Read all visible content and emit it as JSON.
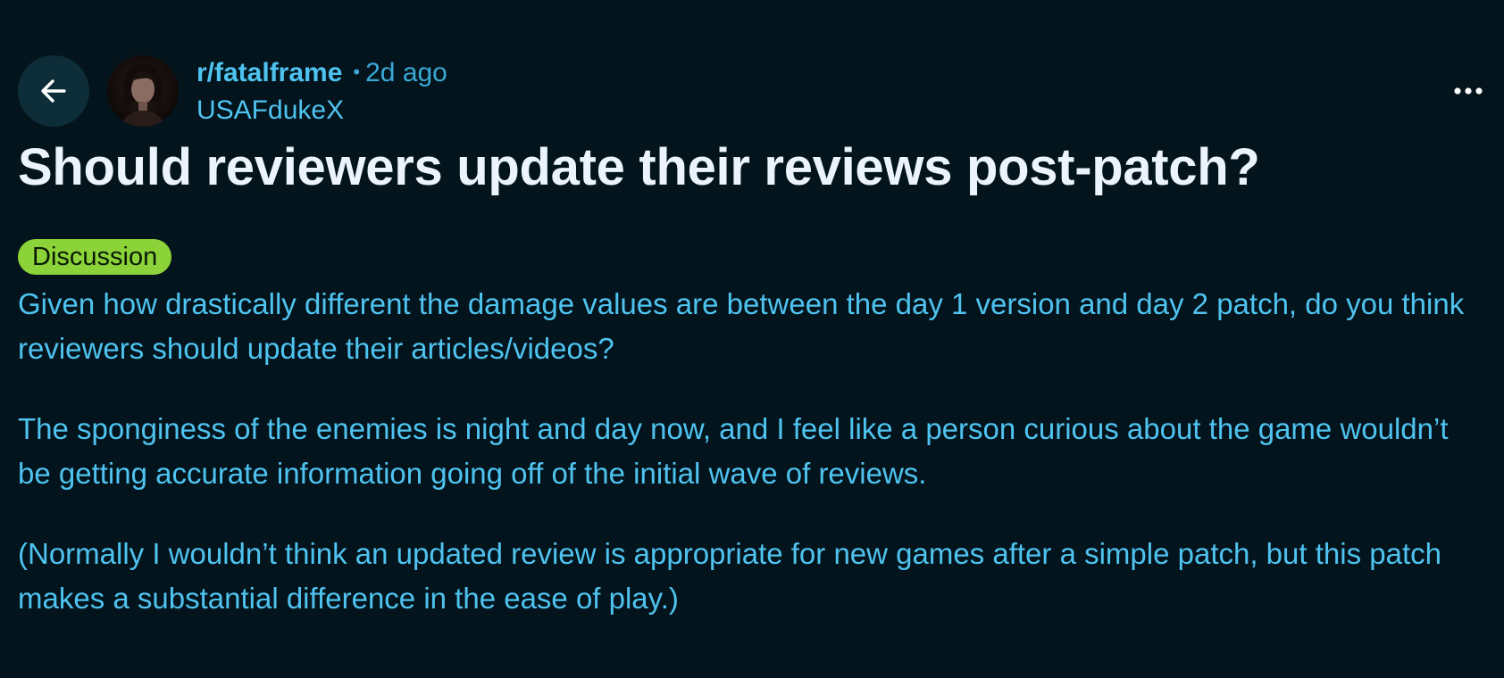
{
  "post": {
    "subreddit": "r/fatalframe",
    "time_ago": "2d ago",
    "author": "USAFdukeX",
    "title": "Should reviewers update their reviews post-patch?",
    "flair": "Discussion",
    "paragraphs": [
      "Given how drastically different the damage values are between the day 1 version and day 2 patch, do you think reviewers should update their articles/videos?",
      "The sponginess of the enemies is night and day now, and I feel like a person curious about the game wouldn’t be getting accurate information going off of the initial wave of reviews.",
      "(Normally I wouldn’t think an updated review is appropriate for new games after a simple patch, but this patch makes a substantial difference in the ease of play.)"
    ]
  },
  "header": {
    "meta_separator": "•",
    "back_icon": "arrow-left-icon",
    "more_icon": "more-horizontal-icon"
  },
  "colors": {
    "background": "#03141c",
    "text_accent": "#4fc3f0",
    "title": "#eaf4fa",
    "flair_bg": "#8cd33a",
    "back_button_bg": "#0d2d38"
  }
}
